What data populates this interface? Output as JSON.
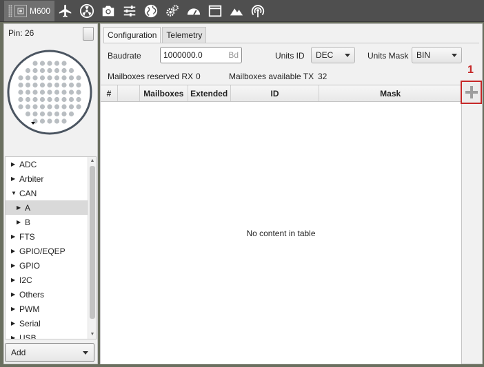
{
  "toolbar": {
    "device_label": "M600",
    "icons": [
      "aircraft-icon",
      "radiation-icon",
      "camera-icon",
      "sliders-icon",
      "globe-icon",
      "gears-icon",
      "gauge-icon",
      "window-icon",
      "mountains-icon",
      "broadcast-icon"
    ]
  },
  "left_panel": {
    "pin_label": "Pin: 26",
    "tree": [
      {
        "label": "ADC",
        "level": 0,
        "expanded": false
      },
      {
        "label": "Arbiter",
        "level": 0,
        "expanded": false
      },
      {
        "label": "CAN",
        "level": 0,
        "expanded": true
      },
      {
        "label": "A",
        "level": 1,
        "expanded": false,
        "selected": true
      },
      {
        "label": "B",
        "level": 1,
        "expanded": false
      },
      {
        "label": "FTS",
        "level": 0,
        "expanded": false
      },
      {
        "label": "GPIO/EQEP",
        "level": 0,
        "expanded": false
      },
      {
        "label": "GPIO",
        "level": 0,
        "expanded": false
      },
      {
        "label": "I2C",
        "level": 0,
        "expanded": false
      },
      {
        "label": "Others",
        "level": 0,
        "expanded": false
      },
      {
        "label": "PWM",
        "level": 0,
        "expanded": false
      },
      {
        "label": "Serial",
        "level": 0,
        "expanded": false
      },
      {
        "label": "USB",
        "level": 0,
        "expanded": false
      }
    ],
    "add_select": "Add"
  },
  "main": {
    "tabs": [
      {
        "label": "Configuration",
        "active": true
      },
      {
        "label": "Telemetry",
        "active": false
      }
    ],
    "baudrate_label": "Baudrate",
    "baudrate_value": "1000000.0",
    "baudrate_unit": "Bd",
    "units_id_label": "Units ID",
    "units_id_value": "DEC",
    "units_mask_label": "Units Mask",
    "units_mask_value": "BIN",
    "rx_label": "Mailboxes reserved RX",
    "rx_value": "0",
    "tx_label": "Mailboxes available TX",
    "tx_value": "32",
    "table_columns": [
      "#",
      "",
      "Mailboxes",
      "Extended",
      "ID",
      "Mask"
    ],
    "empty_message": "No content in table",
    "add_row_symbol": "+",
    "annotation": "1"
  },
  "colors": {
    "toolbar_bg": "#4f4f4f",
    "annotation_red": "#c62828",
    "selected_row": "#d9d9d9"
  }
}
